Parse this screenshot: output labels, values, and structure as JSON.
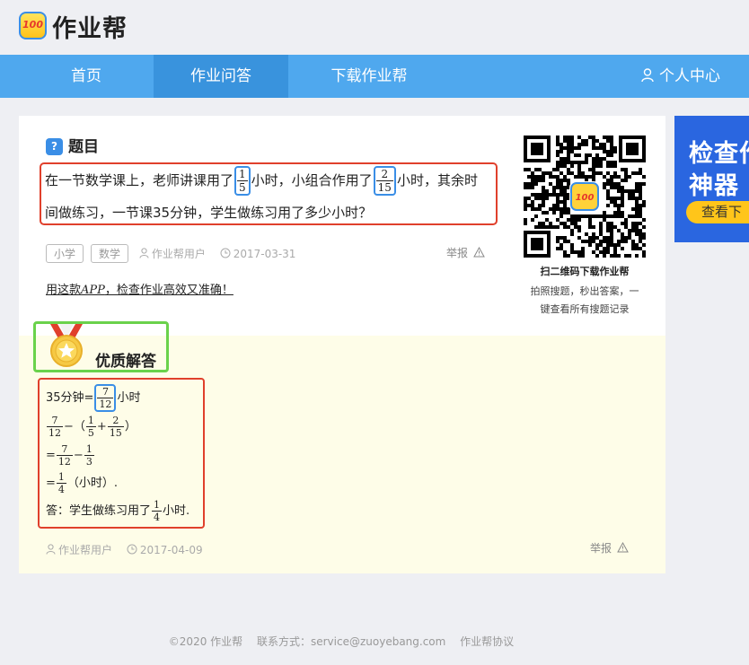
{
  "header": {
    "logo_badge": "100",
    "logo_text": "作业帮"
  },
  "nav": {
    "items": [
      "首页",
      "作业问答",
      "下载作业帮"
    ],
    "active": "作业问答",
    "user_center": "个人中心"
  },
  "question": {
    "section_title": "题目",
    "section_icon": "question-mark-icon",
    "line1_a": "在一节数学课上，老师讲课用了",
    "frac1": {
      "num": "1",
      "den": "5"
    },
    "line1_b": "小时，小组合作用了",
    "frac2": {
      "num": "2",
      "den": "15"
    },
    "line1_c": "小时，其余时",
    "line2": "间做练习，一节课35分钟，学生做练习用了多少小时？",
    "tags": [
      "小学",
      "数学"
    ],
    "user": "作业帮用户",
    "date": "2017-03-31",
    "report": "举报",
    "promo_a": "用这款",
    "promo_app": "APP",
    "promo_b": "，检查作业高效又准确！"
  },
  "qr": {
    "caption_title": "扫二维码下载作业帮",
    "caption_line1": "拍照搜题，秒出答案，一",
    "caption_line2": "键查看所有搜题记录"
  },
  "answer": {
    "section_title": "优质解答",
    "section_icon": "medal-icon",
    "l1_a": "35分钟=",
    "l1_frac": {
      "num": "7",
      "den": "12"
    },
    "l1_b": "小时",
    "l2_frac_a": {
      "num": "7",
      "den": "12"
    },
    "l2_minus": "−（",
    "l2_frac_b": {
      "num": "1",
      "den": "5"
    },
    "l2_plus": "+",
    "l2_frac_c": {
      "num": "2",
      "den": "15"
    },
    "l2_close": "）",
    "l3_eq": "=",
    "l3_frac_a": {
      "num": "7",
      "den": "12"
    },
    "l3_minus": "−",
    "l3_frac_b": {
      "num": "1",
      "den": "3"
    },
    "l4_eq": "=",
    "l4_frac": {
      "num": "1",
      "den": "4"
    },
    "l4_unit": "（小时）.",
    "l5_a": "答：学生做练习用了",
    "l5_frac": {
      "num": "1",
      "den": "4"
    },
    "l5_b": "小时.",
    "user": "作业帮用户",
    "date": "2017-04-09",
    "report": "举报"
  },
  "ad": {
    "line1": "检查作",
    "line2": "神器",
    "button": "查看下"
  },
  "footer": {
    "copyright": "©2020 作业帮",
    "contact": "联系方式：service@zuoyebang.com",
    "agreement": "作业帮协议"
  },
  "colors": {
    "nav_bg": "#4fa8ee",
    "nav_active": "#3993dd",
    "highlight_red": "#e0402c",
    "highlight_blue": "#3a8ee6",
    "highlight_green": "#6ad24b",
    "answer_bg": "#fefde8",
    "ad_bg": "#2a66e0"
  }
}
